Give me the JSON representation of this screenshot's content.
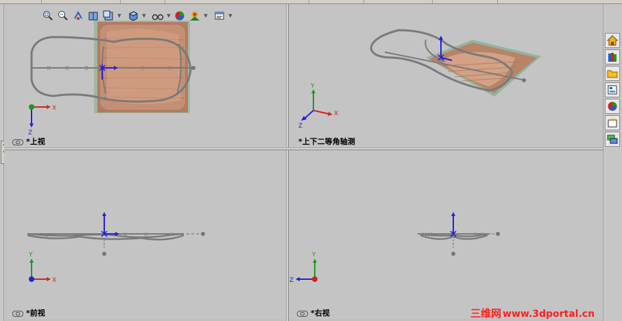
{
  "toolbar": {
    "icons": [
      "zoom-to-fit-icon",
      "zoom-to-area-icon",
      "previous-view-icon",
      "section-view-icon",
      "view-orientation-icon",
      "display-style-icon",
      "hide-show-items-icon",
      "edit-appearance-icon",
      "apply-scene-icon",
      "view-settings-icon"
    ]
  },
  "viewports": {
    "top": {
      "label": "*上视"
    },
    "iso": {
      "label": "*上下二等角轴测"
    },
    "front": {
      "label": "*前视"
    },
    "right": {
      "label": "*右视"
    }
  },
  "triads": {
    "top": {
      "a": "X",
      "b": "Z"
    },
    "iso": {
      "x": "X",
      "y": "Y",
      "z": "Z"
    },
    "front": {
      "x": "X",
      "y": "Y"
    },
    "right": {
      "y": "Y",
      "z": "Z"
    }
  },
  "task_pane": {
    "tabs": [
      "home-icon",
      "design-library-icon",
      "file-explorer-icon",
      "view-palette-icon",
      "appearances-icon",
      "custom-properties-icon",
      "forum-icon"
    ]
  },
  "watermark": {
    "cn": "三维网",
    "url": "www.3dportal.cn"
  },
  "colors": {
    "axis_x": "#d42020",
    "axis_y": "#1a9a1a",
    "axis_z": "#2020d8",
    "sketch": "#7a7a7a",
    "wood": "#b08060"
  }
}
